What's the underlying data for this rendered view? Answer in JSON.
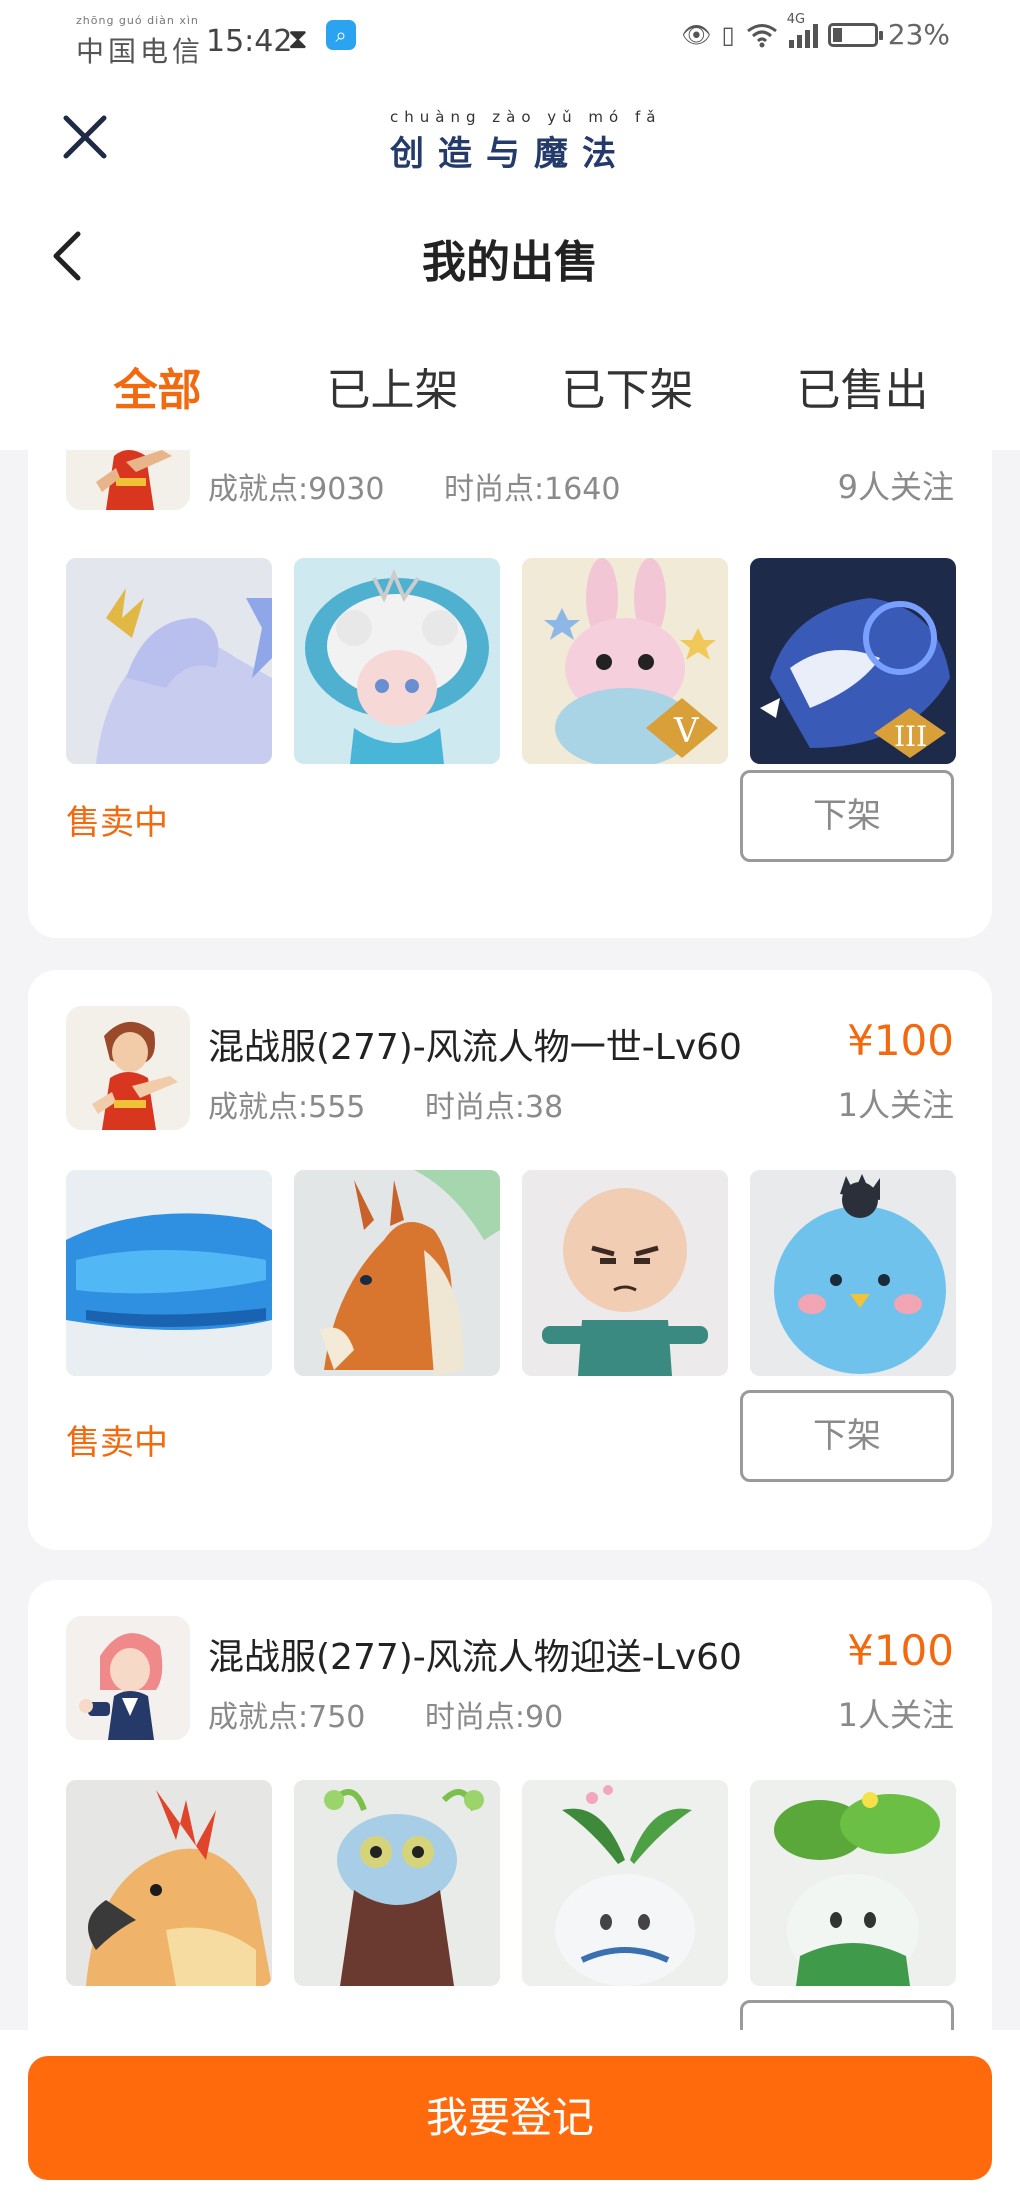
{
  "status_bar": {
    "carrier_pinyin": "zhōng guó diàn xìn",
    "carrier": "中国电信",
    "time": "15:42",
    "network": "4G",
    "battery": "23%",
    "battery_level": 0.23
  },
  "header": {
    "logo_pinyin": "chuàng zào yǔ mó fǎ",
    "logo_text": "创造与魔法",
    "title": "我的出售"
  },
  "tabs": [
    {
      "label": "全部",
      "active": true
    },
    {
      "label": "已上架",
      "active": false
    },
    {
      "label": "已下架",
      "active": false
    },
    {
      "label": "已售出",
      "active": false
    }
  ],
  "listings": [
    {
      "title": "",
      "price": "",
      "achievement": "成就点:9030",
      "fashion": "时尚点:1640",
      "followers": "9人关注",
      "status": "售卖中",
      "action": "下架",
      "thumbs": [
        "ice-horse",
        "cloud-girl",
        "pink-rabbit",
        "armored-tiger"
      ]
    },
    {
      "title": "混战服(277)-风流人物一世-Lv60",
      "price": "¥100",
      "achievement": "成就点:555",
      "fashion": "时尚点:38",
      "followers": "1人关注",
      "status": "售卖中",
      "action": "下架",
      "thumbs": [
        "blue-whale",
        "dragon-horse",
        "bald-kid",
        "blue-bird"
      ]
    },
    {
      "title": "混战服(277)-风流人物迎送-Lv60",
      "price": "¥100",
      "achievement": "成就点:750",
      "fashion": "时尚点:90",
      "followers": "1人关注",
      "status": "",
      "action": "",
      "thumbs": [
        "phoenix",
        "antler-moose",
        "sprout-plant",
        "leafy-plant"
      ]
    }
  ],
  "bottom": {
    "register_label": "我要登记"
  },
  "colors": {
    "accent": "#f26a0f",
    "button": "#ff6a0d"
  }
}
